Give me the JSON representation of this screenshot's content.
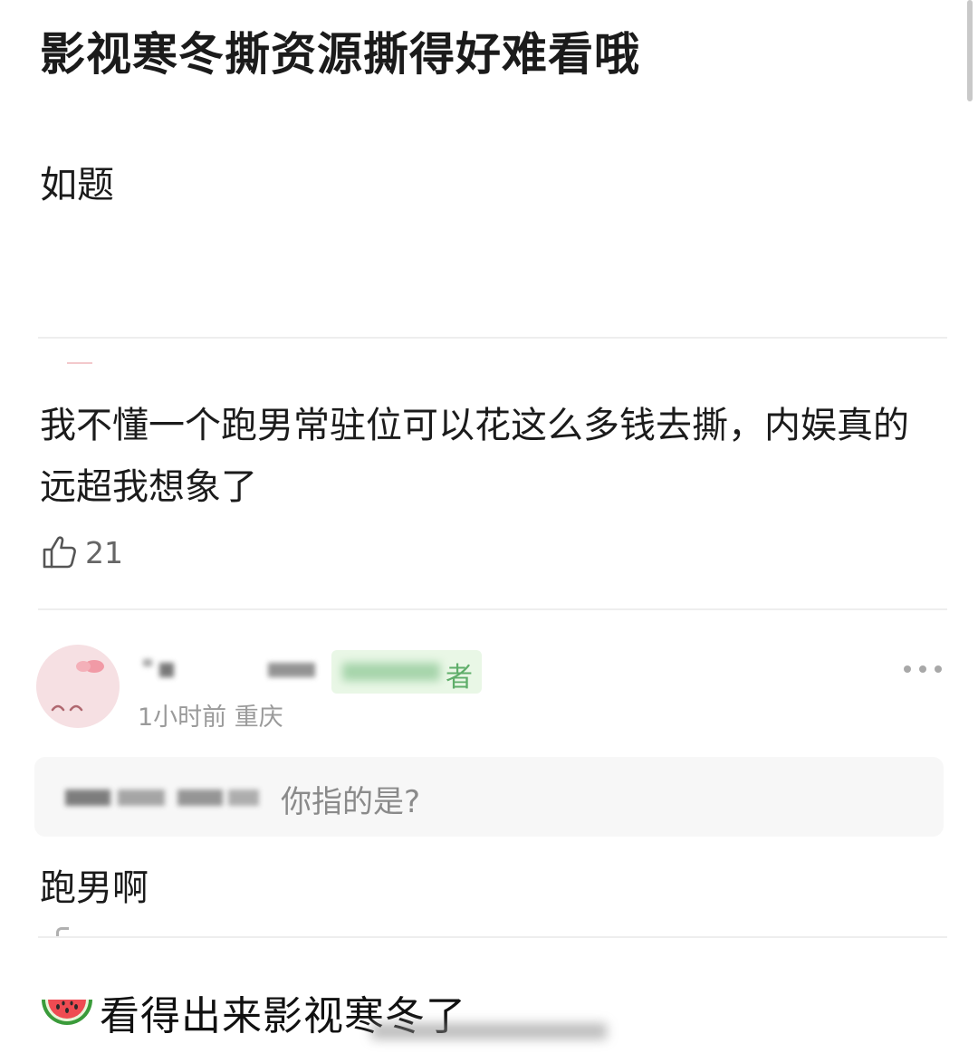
{
  "post": {
    "title": "影视寒冬撕资源撕得好难看哦",
    "body": "如题"
  },
  "top_comment": {
    "text": "我不懂一个跑男常驻位可以花这么多钱去撕，内娱真的远超我想象了",
    "likes": "21"
  },
  "reply": {
    "badge_label": "者",
    "meta": "1小时前 重庆",
    "quote_text": "你指的是?",
    "text": "跑男啊"
  },
  "caption": {
    "text": "看得出来影视寒冬了"
  },
  "icons": {
    "like": "thumbs-up-icon",
    "more": "more-icon",
    "caption_emoji": "watermelon-icon"
  },
  "colors": {
    "badge_green": "#5fae6a",
    "meta_gray": "#9a9a9a",
    "avatar_pink": "#f6e0e3"
  }
}
